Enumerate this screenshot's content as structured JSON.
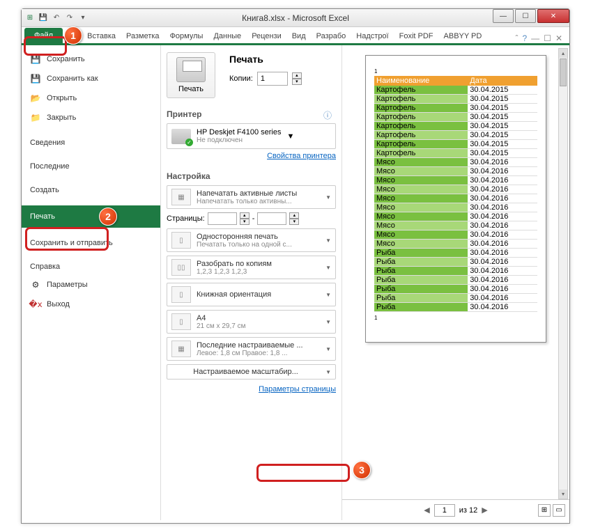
{
  "title": "Книга8.xlsx - Microsoft Excel",
  "tabs": {
    "file": "Файл",
    "home": "ая",
    "insert": "Вставка",
    "layout": "Разметка",
    "formulas": "Формулы",
    "data": "Данные",
    "review": "Рецензи",
    "view": "Вид",
    "dev": "Разрабо",
    "addins": "Надстрої",
    "foxit": "Foxit PDF",
    "abbyy": "ABBYY PD"
  },
  "nav": {
    "save": "Сохранить",
    "saveas": "Сохранить как",
    "open": "Открыть",
    "close": "Закрыть",
    "info": "Сведения",
    "recent": "Последние",
    "new": "Создать",
    "print": "Печать",
    "share": "Сохранить и отправить",
    "help": "Справка",
    "options": "Параметры",
    "exit": "Выход"
  },
  "print": {
    "btn": "Печать",
    "heading": "Печать",
    "copies_label": "Копии:",
    "copies": "1",
    "printer_h": "Принтер",
    "printer_name": "HP Deskjet F4100 series",
    "printer_status": "Не подключен",
    "printer_props": "Свойства принтера",
    "settings_h": "Настройка",
    "s1": {
      "t": "Напечатать активные листы",
      "s": "Напечатать только активны..."
    },
    "pages_label": "Страницы:",
    "pages_sep": "-",
    "s2": {
      "t": "Односторонняя печать",
      "s": "Печатать только на одной с..."
    },
    "s3": {
      "t": "Разобрать по копиям",
      "s": "1,2,3   1,2,3   1,2,3"
    },
    "s4": {
      "t": "Книжная ориентация",
      "s": ""
    },
    "s5": {
      "t": "A4",
      "s": "21 см x 29,7 см"
    },
    "s6": {
      "t": "Последние настраиваемые ...",
      "s": "Левое: 1,8 см   Правое: 1,8 ..."
    },
    "s7": {
      "t": "Настраиваемое масштабир...",
      "s": ""
    },
    "page_setup": "Параметры страницы"
  },
  "preview": {
    "page_top": "1",
    "page_bot": "1",
    "th1": "Наименование",
    "th2": "Дата",
    "rows": [
      [
        "Картофель",
        "30.04.2015"
      ],
      [
        "Картофель",
        "30.04.2015"
      ],
      [
        "Картофель",
        "30.04.2015"
      ],
      [
        "Картофель",
        "30.04.2015"
      ],
      [
        "Картофель",
        "30.04.2015"
      ],
      [
        "Картофель",
        "30.04.2015"
      ],
      [
        "Картофель",
        "30.04.2015"
      ],
      [
        "Картофель",
        "30.04.2015"
      ],
      [
        "Мясо",
        "30.04.2016"
      ],
      [
        "Мясо",
        "30.04.2016"
      ],
      [
        "Мясо",
        "30.04.2016"
      ],
      [
        "Мясо",
        "30.04.2016"
      ],
      [
        "Мясо",
        "30.04.2016"
      ],
      [
        "Мясо",
        "30.04.2016"
      ],
      [
        "Мясо",
        "30.04.2016"
      ],
      [
        "Мясо",
        "30.04.2016"
      ],
      [
        "Мясо",
        "30.04.2016"
      ],
      [
        "Мясо",
        "30.04.2016"
      ],
      [
        "Рыба",
        "30.04.2016"
      ],
      [
        "Рыба",
        "30.04.2016"
      ],
      [
        "Рыба",
        "30.04.2016"
      ],
      [
        "Рыба",
        "30.04.2016"
      ],
      [
        "Рыба",
        "30.04.2016"
      ],
      [
        "Рыба",
        "30.04.2016"
      ],
      [
        "Рыба",
        "30.04.2016"
      ]
    ],
    "nav_cur": "1",
    "nav_total": "из 12"
  },
  "callouts": {
    "c1": "1",
    "c2": "2",
    "c3": "3"
  }
}
